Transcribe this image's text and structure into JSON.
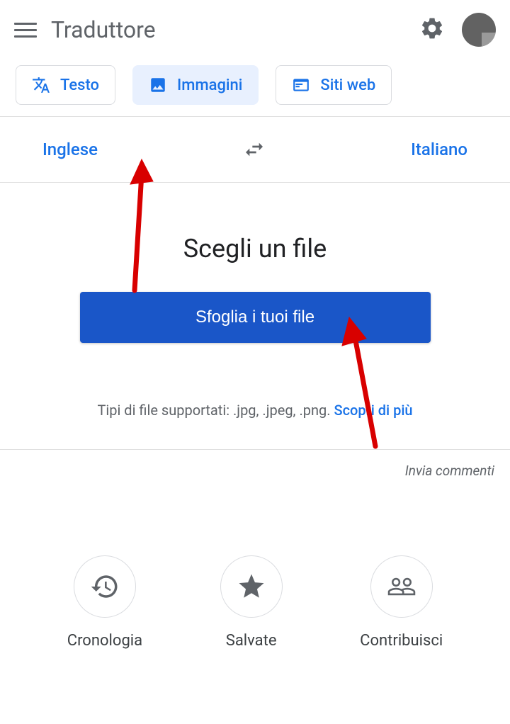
{
  "header": {
    "app_title": "Traduttore"
  },
  "tabs": {
    "text": "Testo",
    "images": "Immagini",
    "websites": "Siti web"
  },
  "languages": {
    "source": "Inglese",
    "target": "Italiano"
  },
  "file_picker": {
    "title": "Scegli un file",
    "browse_label": "Sfoglia i tuoi file",
    "supported_prefix": "Tipi di file supportati: .jpg, .jpeg, .png. ",
    "learn_more": "Scopri di più"
  },
  "feedback": "Invia commenti",
  "bottom_actions": {
    "history": "Cronologia",
    "saved": "Salvate",
    "contribute": "Contribuisci"
  }
}
